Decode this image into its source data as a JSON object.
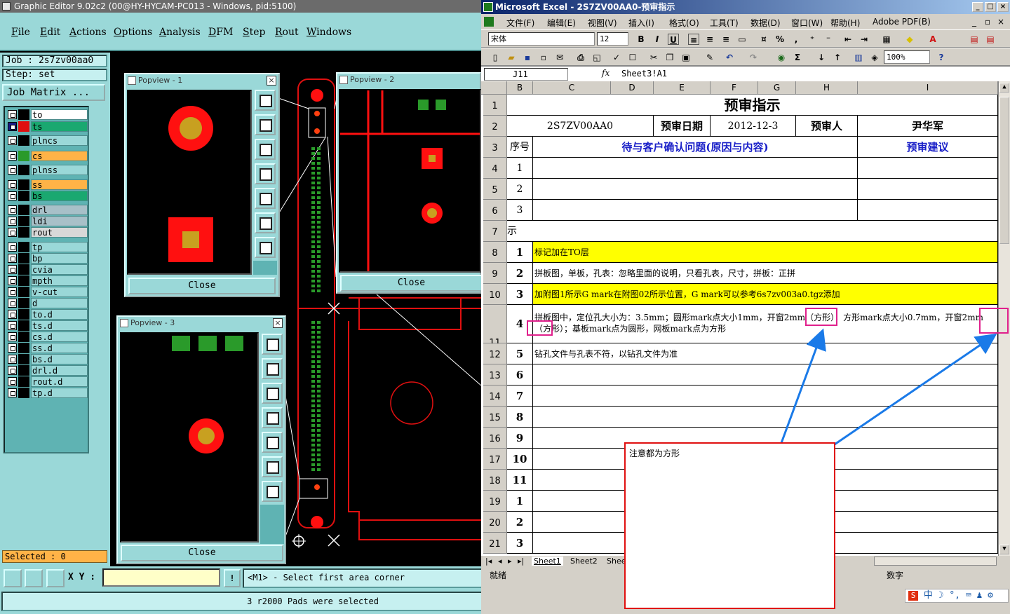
{
  "graphic_editor": {
    "title": "Graphic Editor 9.02c2 (00@HY-HYCAM-PC013 - Windows, pid:5100)",
    "menu": [
      "File",
      "Edit",
      "Actions",
      "Options",
      "Analysis",
      "DFM",
      "Step",
      "Rout",
      "Windows"
    ],
    "job_label": "Job : 2s7zv00aa0",
    "step_label": "Step: set",
    "job_matrix": "Job Matrix ...",
    "layers": [
      {
        "name": "to",
        "color": "#000000",
        "bg": "#ffffff",
        "checked": false
      },
      {
        "name": "ts",
        "color": "#e01010",
        "bg": "#1aa870",
        "checked": true
      },
      {
        "name": "plncs",
        "color": "#000000",
        "bg": "#9ad8d8",
        "checked": false
      },
      {
        "name": "cs",
        "color": "#2a9a2a",
        "bg": "#ffb347",
        "checked": false
      },
      {
        "name": "plnss",
        "color": "#000000",
        "bg": "#9ad8d8",
        "checked": false
      },
      {
        "name": "ss",
        "color": "#000000",
        "bg": "#ffb347",
        "checked": false
      },
      {
        "name": "bs",
        "color": "#000000",
        "bg": "#1aa870",
        "checked": false
      },
      {
        "name": "drl",
        "color": "#000000",
        "bg": "#a8c0c8",
        "checked": false
      },
      {
        "name": "ldi",
        "color": "#000000",
        "bg": "#a8c0c8",
        "checked": false
      },
      {
        "name": "rout",
        "color": "#000000",
        "bg": "#d8d8d8",
        "checked": false
      },
      {
        "name": "tp",
        "color": "#000000",
        "bg": "#9ad8d8",
        "checked": false
      },
      {
        "name": "bp",
        "color": "#000000",
        "bg": "#9ad8d8",
        "checked": false
      },
      {
        "name": "cvia",
        "color": "#000000",
        "bg": "#9ad8d8",
        "checked": false
      },
      {
        "name": "mpth",
        "color": "#000000",
        "bg": "#9ad8d8",
        "checked": false
      },
      {
        "name": "v-cut",
        "color": "#000000",
        "bg": "#9ad8d8",
        "checked": false
      },
      {
        "name": "d",
        "color": "#000000",
        "bg": "#9ad8d8",
        "checked": false
      },
      {
        "name": "to.d",
        "color": "#000000",
        "bg": "#9ad8d8",
        "checked": false
      },
      {
        "name": "ts.d",
        "color": "#000000",
        "bg": "#9ad8d8",
        "checked": false
      },
      {
        "name": "cs.d",
        "color": "#000000",
        "bg": "#9ad8d8",
        "checked": false
      },
      {
        "name": "ss.d",
        "color": "#000000",
        "bg": "#9ad8d8",
        "checked": false
      },
      {
        "name": "bs.d",
        "color": "#000000",
        "bg": "#9ad8d8",
        "checked": false
      },
      {
        "name": "drl.d",
        "color": "#000000",
        "bg": "#9ad8d8",
        "checked": false
      },
      {
        "name": "rout.d",
        "color": "#000000",
        "bg": "#9ad8d8",
        "checked": false
      },
      {
        "name": "tp.d",
        "color": "#000000",
        "bg": "#9ad8d8",
        "checked": false
      }
    ],
    "selected": "Selected : 0",
    "xy_label": "X Y :",
    "xy_value": "",
    "message": "<M1> - Select first area corner",
    "status": "3 r2000 Pads were selected",
    "popviews": [
      {
        "title": "Popview - 1",
        "close": "Close"
      },
      {
        "title": "Popview - 2",
        "close": "Close"
      },
      {
        "title": "Popview - 3",
        "close": "Close"
      }
    ]
  },
  "excel": {
    "title": "Microsoft Excel - 2S7ZV00AA0-预审指示",
    "menu": [
      "文件(F)",
      "编辑(E)",
      "视图(V)",
      "插入(I)",
      "格式(O)",
      "工具(T)",
      "数据(D)",
      "窗口(W)",
      "帮助(H)",
      "Adobe PDF(B)"
    ],
    "font_name": "宋体",
    "font_size": "12",
    "zoom": "100%",
    "name_box": "J11",
    "formula": "Sheet3!A1",
    "columns": [
      "B",
      "C",
      "D",
      "E",
      "F",
      "G",
      "H",
      "I"
    ],
    "sheet_title": "预审指示",
    "job_no": "2S7ZV00AA0",
    "date_label": "预审日期",
    "date_value": "2012-12-3",
    "reviewer_label": "预审人",
    "reviewer_value": "尹华军",
    "seq_header": "序号",
    "issues_header": "待与客户确认问题(原因与内容)",
    "advice_header": "预审建议",
    "row_numbers": [
      "1",
      "2",
      "3",
      "4",
      "5",
      "6",
      "7",
      "8",
      "9",
      "10",
      "11",
      "12",
      "13",
      "14",
      "15",
      "16",
      "17",
      "18",
      "19",
      "20",
      "21"
    ],
    "top_seq": [
      "1",
      "2",
      "3"
    ],
    "row7_label": "示",
    "items": [
      {
        "seq": "1",
        "text": "标记加在TO层",
        "highlight": "#ffff00"
      },
      {
        "seq": "2",
        "text": "拼板图，单板，孔表：忽略里面的说明，只看孔表，尺寸，拼板：正拼",
        "highlight": ""
      },
      {
        "seq": "3",
        "text": "加附图1所示G mark在附图02所示位置，G mark可以参考6s7zv003a0.tgz添加",
        "highlight": "#ffff00"
      },
      {
        "seq": "4",
        "text": "拼板图中，定位孔大小为：3.5mm；圆形mark点大小1mm，开窗2mm（方形），方形mark点大小0.7mm，开窗2mm（方形）；基板mark点为圆形，网板mark点为方形",
        "highlight": ""
      },
      {
        "seq": "5",
        "text": "钻孔文件与孔表不符，以钻孔文件为准",
        "highlight": ""
      },
      {
        "seq": "6",
        "text": "",
        "highlight": ""
      },
      {
        "seq": "7",
        "text": "",
        "highlight": ""
      },
      {
        "seq": "8",
        "text": "",
        "highlight": ""
      },
      {
        "seq": "9",
        "text": "",
        "highlight": ""
      },
      {
        "seq": "10",
        "text": "",
        "highlight": ""
      },
      {
        "seq": "11",
        "text": "",
        "highlight": ""
      },
      {
        "seq": "1",
        "text": "",
        "highlight": ""
      },
      {
        "seq": "2",
        "text": "",
        "highlight": ""
      },
      {
        "seq": "3",
        "text": "",
        "highlight": ""
      }
    ],
    "tabs": [
      "Sheet1",
      "Sheet2",
      "Shee"
    ],
    "status_ready": "就绪",
    "status_num": "数字",
    "callout_text": "注意都为方形"
  },
  "taskbar": {
    "ime": "中"
  }
}
